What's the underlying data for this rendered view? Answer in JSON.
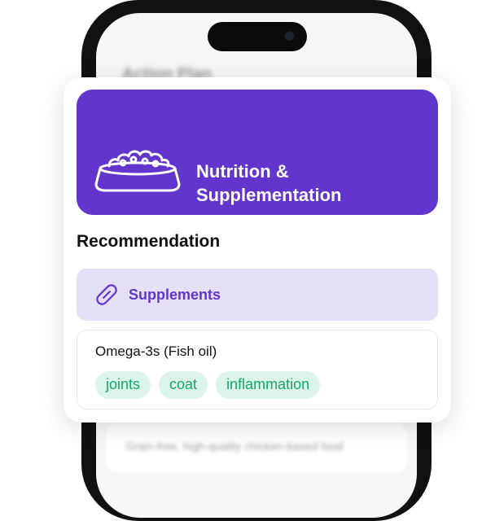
{
  "background_screen": {
    "title": "Action Plan",
    "blurred_text": "Grain-free, high-quality chicken-based food"
  },
  "card": {
    "header": {
      "icon": "food-bowl-icon",
      "title": "Nutrition &\nSupplementation",
      "color": "#6236cc"
    },
    "recommendation_heading": "Recommendation",
    "category": {
      "icon": "pill-icon",
      "label": "Supplements",
      "color": "#e6dff8"
    },
    "item": {
      "name": "Omega-3s (Fish oil)",
      "tags": [
        "joints",
        "coat",
        "inflammation"
      ],
      "tag_color": "#19a46b"
    }
  }
}
